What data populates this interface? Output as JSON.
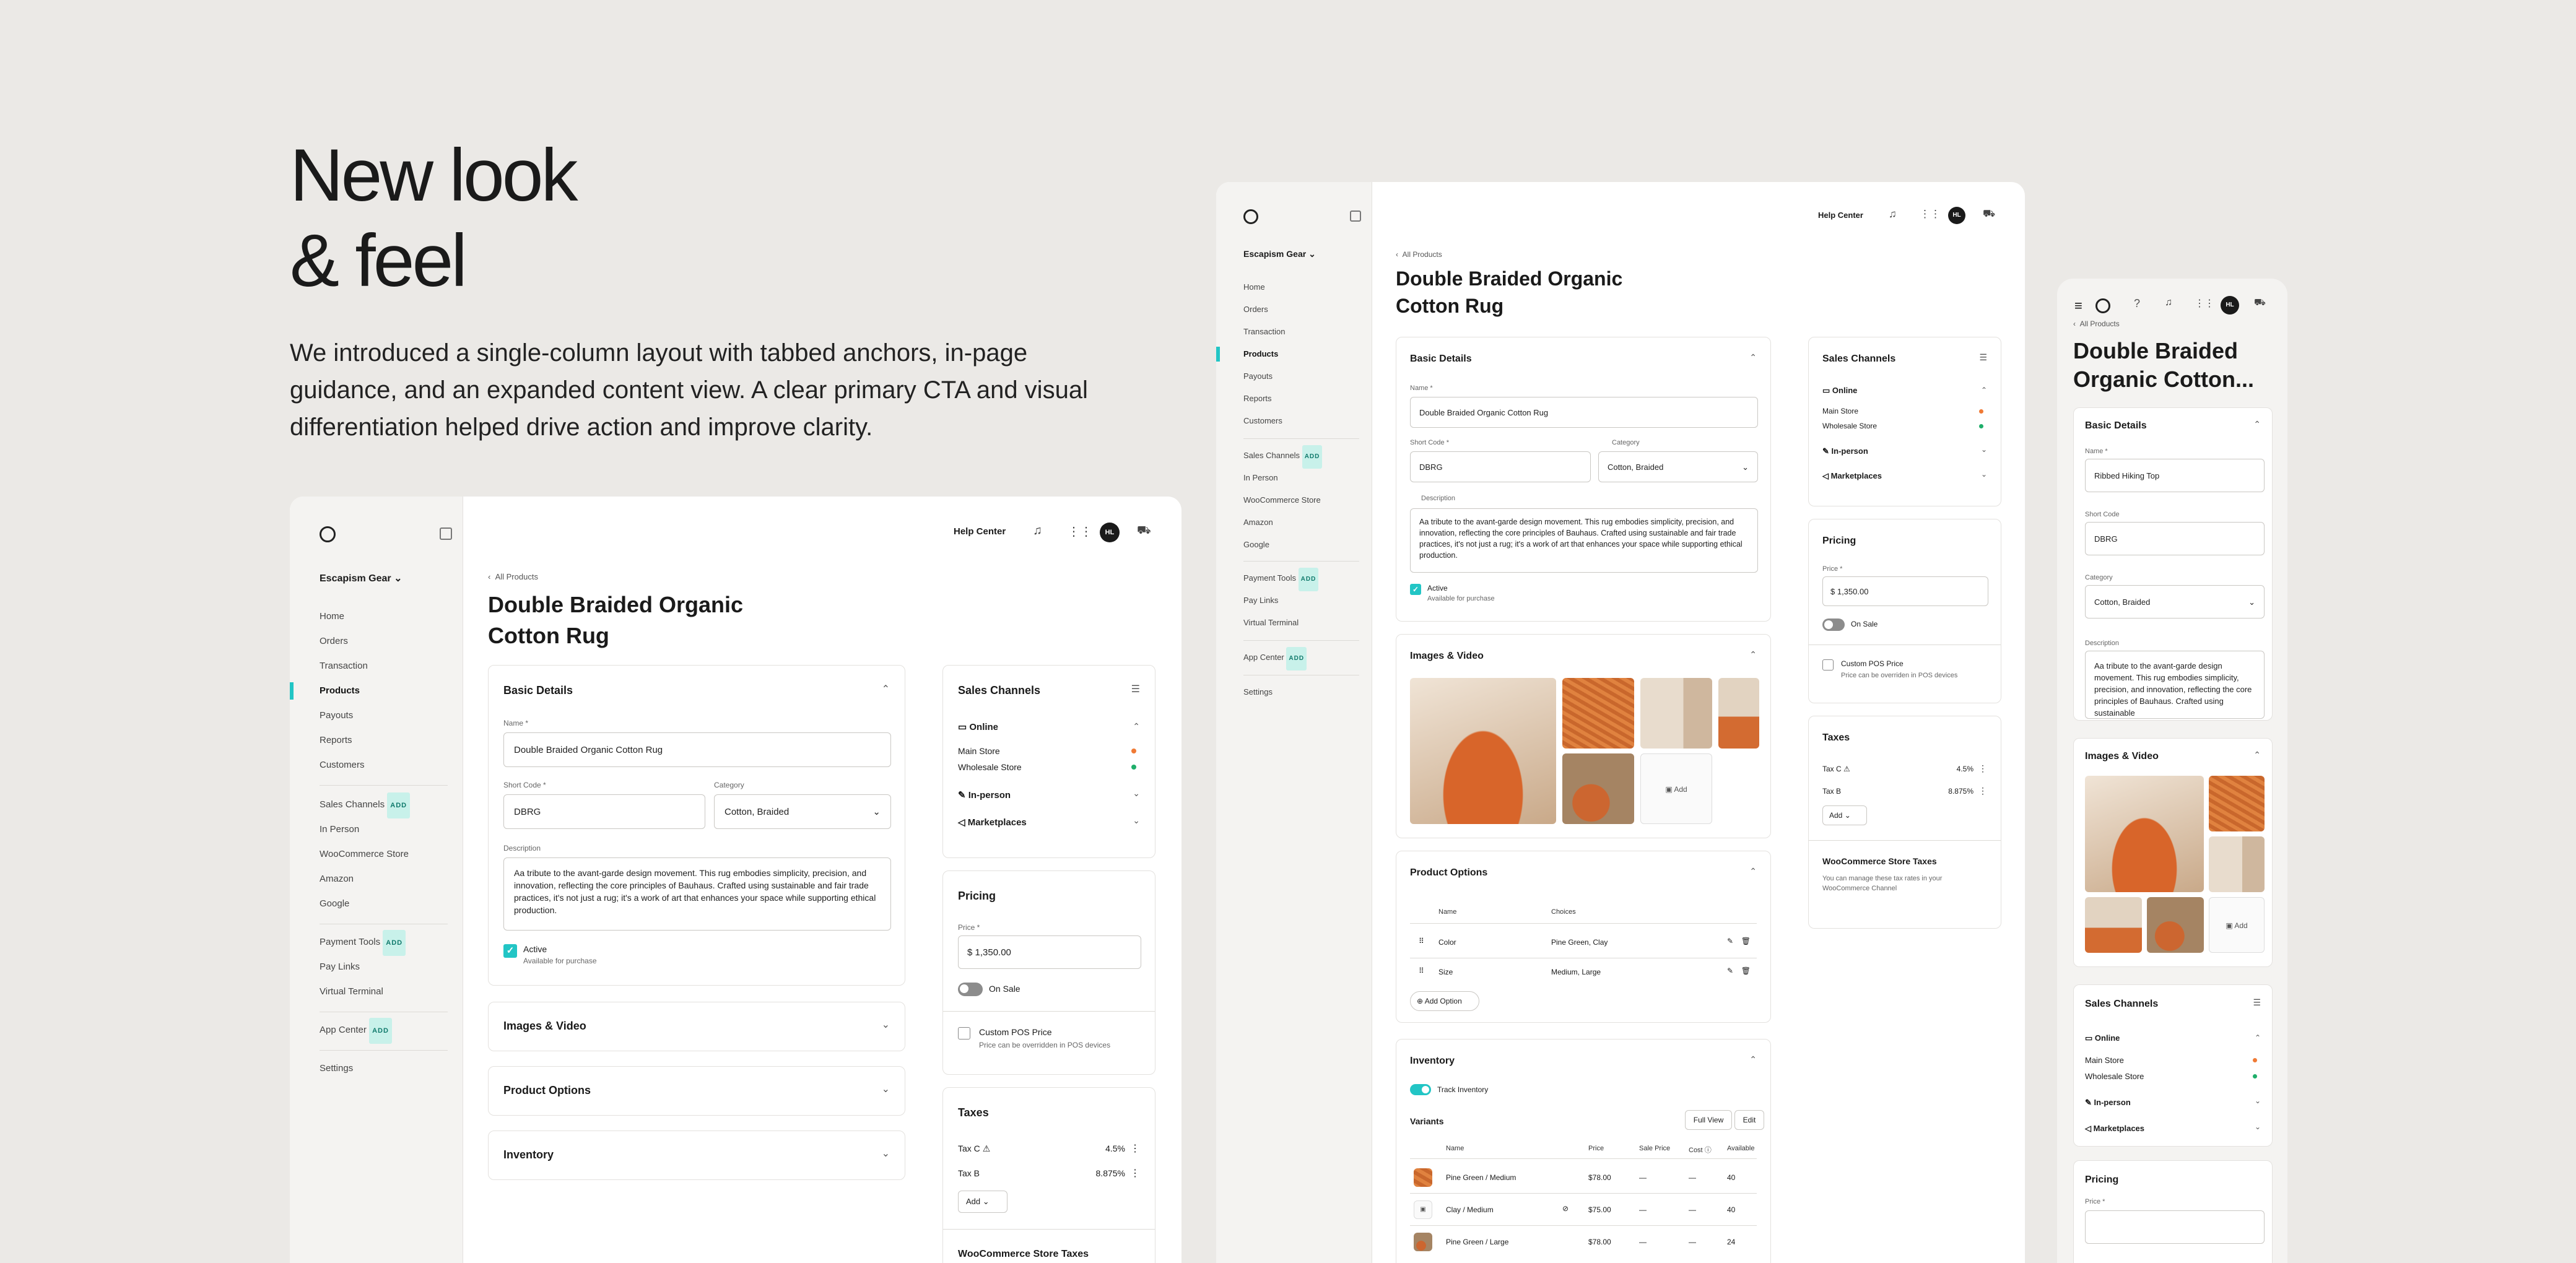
{
  "hero": {
    "title": "New look\n& feel",
    "description": "We introduced a single-column layout with tabbed anchors, in-page guidance, and an expanded content view. A clear primary CTA and visual differentiation helped drive action and improve clarity."
  },
  "common": {
    "store_name": "Escapism Gear",
    "help_center": "Help Center",
    "avatar_initials": "HL",
    "back_link": "All Products",
    "add_badge": "ADD",
    "nav_main": [
      "Home",
      "Orders",
      "Transaction",
      "Products",
      "Payouts",
      "Reports",
      "Customers"
    ],
    "nav_active_index": 3,
    "nav_channels": [
      "Sales Channels",
      "In Person",
      "WooCommerce Store",
      "Amazon",
      "Google"
    ],
    "nav_payments": [
      "Payment Tools",
      "Pay Links",
      "Virtual Terminal"
    ],
    "app_center": "App Center",
    "settings": "Settings",
    "product_title": "Double Braided Organic Cotton Rug",
    "basic_details": "Basic Details",
    "name_label": "Name *",
    "name_value": "Double Braided Organic Cotton Rug",
    "short_code_label": "Short Code *",
    "short_code_value": "DBRG",
    "category_label": "Category",
    "category_value": "Cotton, Braided",
    "description_label": "Description",
    "description_value": "Aa tribute to the avant-garde design movement. This rug embodies simplicity, precision, and innovation, reflecting the core principles of Bauhaus. Crafted using sustainable and fair trade practices, it's not just a rug; it's a work of art that enhances your space while supporting ethical production.",
    "active_label": "Active",
    "active_sub": "Available for purchase",
    "images_video": "Images & Video",
    "product_options": "Product Options",
    "inventory": "Inventory",
    "sales_channels": "Sales Channels",
    "online": "Online",
    "main_store": "Main Store",
    "wholesale_store": "Wholesale Store",
    "main_store_color": "#f07a35",
    "wholesale_color": "#1fae6a",
    "in_person": "In-person",
    "marketplaces": "Marketplaces",
    "pricing": "Pricing",
    "price_label": "Price *",
    "price_value": "$  1,350.00",
    "on_sale": "On Sale",
    "custom_pos": "Custom POS Price",
    "custom_pos_sub_a": "Price can be overridden in POS devices",
    "custom_pos_sub_b": "Price can be overriden in POS devices",
    "taxes": "Taxes",
    "tax_c": "Tax C",
    "tax_c_value": "4.5%",
    "tax_b": "Tax B",
    "tax_b_value": "8.875%",
    "add": "Add",
    "woo_taxes": "WooCommerce Store Taxes",
    "woo_taxes_sub": "You can manage these tax rates in your WooCommerce Channel",
    "accent": "#22c5c5"
  },
  "middle": {
    "options_head": [
      "Name",
      "Choices"
    ],
    "options": [
      {
        "name": "Color",
        "choices": "Pine Green, Clay"
      },
      {
        "name": "Size",
        "choices": "Medium, Large"
      }
    ],
    "add_option": "Add Option",
    "track_inventory": "Track Inventory",
    "variants": "Variants",
    "full_view": "Full View",
    "edit": "Edit",
    "variant_head": [
      "Name",
      "Price",
      "Sale Price",
      "Cost",
      "Available"
    ],
    "variant_rows": [
      {
        "name": "Pine Green / Medium",
        "price": "$78.00",
        "sale": "—",
        "cost": "—",
        "avail": "40"
      },
      {
        "name": "Clay / Medium",
        "price": "$75.00",
        "sale": "—",
        "cost": "—",
        "avail": "40"
      },
      {
        "name": "Pine Green / Large",
        "price": "$78.00",
        "sale": "—",
        "cost": "—",
        "avail": "24"
      }
    ]
  },
  "mobile": {
    "title": "Double Braided Organic Cotton...",
    "name_label": "Name *",
    "name_value": "Ribbed Hiking Top",
    "short_code_label": "Short Code",
    "short_code_value": "DBRG",
    "category_label": "Category",
    "category_value": "Cotton, Braided",
    "description_label": "Description",
    "description_value": "Aa tribute to the avant-garde design movement. This rug embodies simplicity, precision, and innovation, reflecting the core principles of Bauhaus. Crafted using sustainable",
    "price_label": "Price *"
  }
}
